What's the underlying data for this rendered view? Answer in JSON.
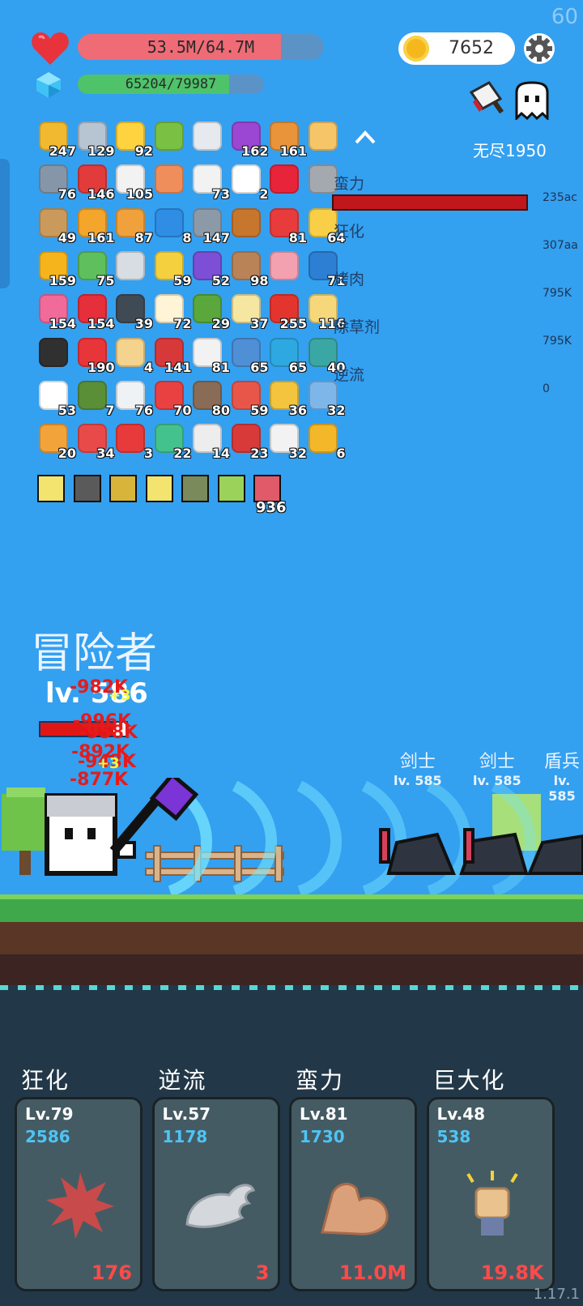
{
  "fps": "60",
  "player": {
    "hp_text": "53.5M/64.7M",
    "hp_fraction": 0.827,
    "xp_text": "65204/79987",
    "xp_fraction": 0.815,
    "coins": "7652"
  },
  "mode": {
    "label": "无尽1950"
  },
  "items": [
    {
      "icon": "corn-icon",
      "count": "247",
      "color": "#f1b92f"
    },
    {
      "icon": "sword-icon",
      "count": "129",
      "color": "#b7c4d2"
    },
    {
      "icon": "lightbulb-icon",
      "count": "92",
      "color": "#ffd23f"
    },
    {
      "icon": "potion-flask-icon",
      "count": "",
      "color": "#7ac143"
    },
    {
      "icon": "dagger-icon",
      "count": "",
      "color": "#e6e9ee"
    },
    {
      "icon": "purple-bomb-icon",
      "count": "162",
      "color": "#9b47d3"
    },
    {
      "icon": "book-icon",
      "count": "161",
      "color": "#e9943a"
    },
    {
      "icon": "scroll-icon",
      "count": "",
      "color": "#f5c567"
    },
    {
      "icon": "spiked-ball-icon",
      "count": "76",
      "color": "#8596a8"
    },
    {
      "icon": "mushroom-icon",
      "count": "146",
      "color": "#e23b3b"
    },
    {
      "icon": "flag-icon",
      "count": "105",
      "color": "#f2f2f2"
    },
    {
      "icon": "crown-icon",
      "count": "",
      "color": "#ef8e5a"
    },
    {
      "icon": "dice-icon",
      "count": "73",
      "color": "#f2f2f2"
    },
    {
      "icon": "speech-bubble-icon",
      "count": "2",
      "color": "#ffffff"
    },
    {
      "icon": "ruby-icon",
      "count": "",
      "color": "#e8243a"
    },
    {
      "icon": "helmet-icon",
      "count": "",
      "color": "#a4a9b0"
    },
    {
      "icon": "bow-icon",
      "count": "49",
      "color": "#c99a5b"
    },
    {
      "icon": "pineapple-icon",
      "count": "161",
      "color": "#f3a52c"
    },
    {
      "icon": "briefcase-icon",
      "count": "87",
      "color": "#f0a13c"
    },
    {
      "icon": "target-icon",
      "count": "8",
      "color": "#2f8de4"
    },
    {
      "icon": "brain-icon",
      "count": "147",
      "color": "#8c9aa8"
    },
    {
      "icon": "meat-leg-icon",
      "count": "",
      "color": "#c7762e"
    },
    {
      "icon": "gift-box-icon",
      "count": "81",
      "color": "#e83c3c"
    },
    {
      "icon": "cheese-icon",
      "count": "64",
      "color": "#f8cf46"
    },
    {
      "icon": "sunflower-icon",
      "count": "159",
      "color": "#f5b31c"
    },
    {
      "icon": "money-heart-icon",
      "count": "75",
      "color": "#5fbf5c"
    },
    {
      "icon": "hook-icon",
      "count": "",
      "color": "#d7dde3"
    },
    {
      "icon": "magic-wand-icon",
      "count": "59",
      "color": "#f4d03f"
    },
    {
      "icon": "purple-chest-icon",
      "count": "52",
      "color": "#7c4fd6"
    },
    {
      "icon": "donut-icon",
      "count": "98",
      "color": "#b98357"
    },
    {
      "icon": "pink-heart-icon",
      "count": "",
      "color": "#f3a0b0"
    },
    {
      "icon": "star-card-icon",
      "count": "71",
      "color": "#2d7fd3"
    },
    {
      "icon": "pink-potion-icon",
      "count": "154",
      "color": "#f06a9a"
    },
    {
      "icon": "red-heart-icon",
      "count": "154",
      "color": "#e52f3b"
    },
    {
      "icon": "dark-tome-icon",
      "count": "39",
      "color": "#3f4a55"
    },
    {
      "icon": "fried-egg-icon",
      "count": "72",
      "color": "#fff4d6"
    },
    {
      "icon": "green-shell-icon",
      "count": "29",
      "color": "#5aa83b"
    },
    {
      "icon": "halo-icon",
      "count": "37",
      "color": "#f5e6a2"
    },
    {
      "icon": "apple-icon",
      "count": "255",
      "color": "#e3352e"
    },
    {
      "icon": "note-pencil-icon",
      "count": "116",
      "color": "#f6d77a"
    },
    {
      "icon": "bat-icon",
      "count": "",
      "color": "#303030"
    },
    {
      "icon": "strawberry-icon",
      "count": "190",
      "color": "#e8353a"
    },
    {
      "icon": "treasure-map-icon",
      "count": "4",
      "color": "#f3d38d"
    },
    {
      "icon": "red-boot-icon",
      "count": "141",
      "color": "#d7393b"
    },
    {
      "icon": "envelope-icon",
      "count": "81",
      "color": "#f2f2f2"
    },
    {
      "icon": "shield-icon",
      "count": "65",
      "color": "#4f8fd6"
    },
    {
      "icon": "chat-bubble-icon",
      "count": "65",
      "color": "#2ea8e0"
    },
    {
      "icon": "vinyl-disc-icon",
      "count": "40",
      "color": "#3aa7a5"
    },
    {
      "icon": "ghost-icon",
      "count": "53",
      "color": "#ffffff"
    },
    {
      "icon": "grenade-icon",
      "count": "7",
      "color": "#5b8f37"
    },
    {
      "icon": "clipboard-icon",
      "count": "76",
      "color": "#eef2f5"
    },
    {
      "icon": "playing-cards-icon",
      "count": "70",
      "color": "#e94141"
    },
    {
      "icon": "tombstone-icon",
      "count": "80",
      "color": "#8a6b55"
    },
    {
      "icon": "thermometer-icon",
      "count": "59",
      "color": "#e8564a"
    },
    {
      "icon": "ring-icon",
      "count": "36",
      "color": "#f3c43d"
    },
    {
      "icon": "robe-icon",
      "count": "32",
      "color": "#7eb6ea"
    },
    {
      "icon": "meteor-icon",
      "count": "20",
      "color": "#f2a33a"
    },
    {
      "icon": "watermelon-icon",
      "count": "34",
      "color": "#e84a4a"
    },
    {
      "icon": "percent-tag-icon",
      "count": "3",
      "color": "#e83a3a"
    },
    {
      "icon": "green-spirit-icon",
      "count": "22",
      "color": "#44c28e"
    },
    {
      "icon": "bulb-face-icon",
      "count": "14",
      "color": "#ededed"
    },
    {
      "icon": "red-shield-icon",
      "count": "23",
      "color": "#d83a3a"
    },
    {
      "icon": "cloud-icon",
      "count": "32",
      "color": "#f2f2f2"
    },
    {
      "icon": "gold-coins-icon",
      "count": "6",
      "color": "#f3b729"
    }
  ],
  "relics": [
    {
      "icon": "lamp-relic-icon",
      "color": "#f3e36f"
    },
    {
      "icon": "blade-relic-icon",
      "color": "#5a5a5a"
    },
    {
      "icon": "dark-mask-relic-icon",
      "color": "#d9b43a"
    },
    {
      "icon": "lamp-relic-icon",
      "color": "#f3e36f"
    },
    {
      "icon": "pot-relic-icon",
      "color": "#7a8a5a"
    },
    {
      "icon": "sword-leaf-relic-icon",
      "color": "#9ad25a"
    },
    {
      "icon": "dagger-relic-icon",
      "color": "#e05a6a"
    }
  ],
  "relic_count": "936",
  "skill_list": [
    {
      "name": "蛮力",
      "value": "235ac"
    },
    {
      "name": "狂化",
      "value": "307aa"
    },
    {
      "name": "烤肉",
      "value": "795K"
    },
    {
      "name": "除草剂",
      "value": "795K"
    },
    {
      "name": "逆流",
      "value": "0"
    }
  ],
  "hero": {
    "title": "冒险者",
    "level": "lv. 586",
    "hp_fraction": 0.85
  },
  "damage_numbers": [
    "-982K",
    "-996K",
    "-958K",
    "-892K",
    "-943K",
    "-877K"
  ],
  "buff_numbers": [
    "+3",
    "+3"
  ],
  "enemies": [
    {
      "name": "剑士",
      "level": "lv. 585"
    },
    {
      "name": "剑士",
      "level": "lv. 585"
    },
    {
      "name": "盾兵",
      "level": "lv. 585"
    }
  ],
  "skill_cards": [
    {
      "title": "狂化",
      "level": "Lv.79",
      "cost": "2586",
      "value": "176",
      "icon": "burst-icon"
    },
    {
      "title": "逆流",
      "level": "Lv.57",
      "cost": "1178",
      "value": "3",
      "icon": "wing-icon"
    },
    {
      "title": "蛮力",
      "level": "Lv.81",
      "cost": "1730",
      "value": "11.0M",
      "icon": "muscle-arm-icon"
    },
    {
      "title": "巨大化",
      "level": "Lv.48",
      "cost": "538",
      "value": "19.8K",
      "icon": "raised-fist-icon"
    }
  ],
  "version": "1.17.1"
}
